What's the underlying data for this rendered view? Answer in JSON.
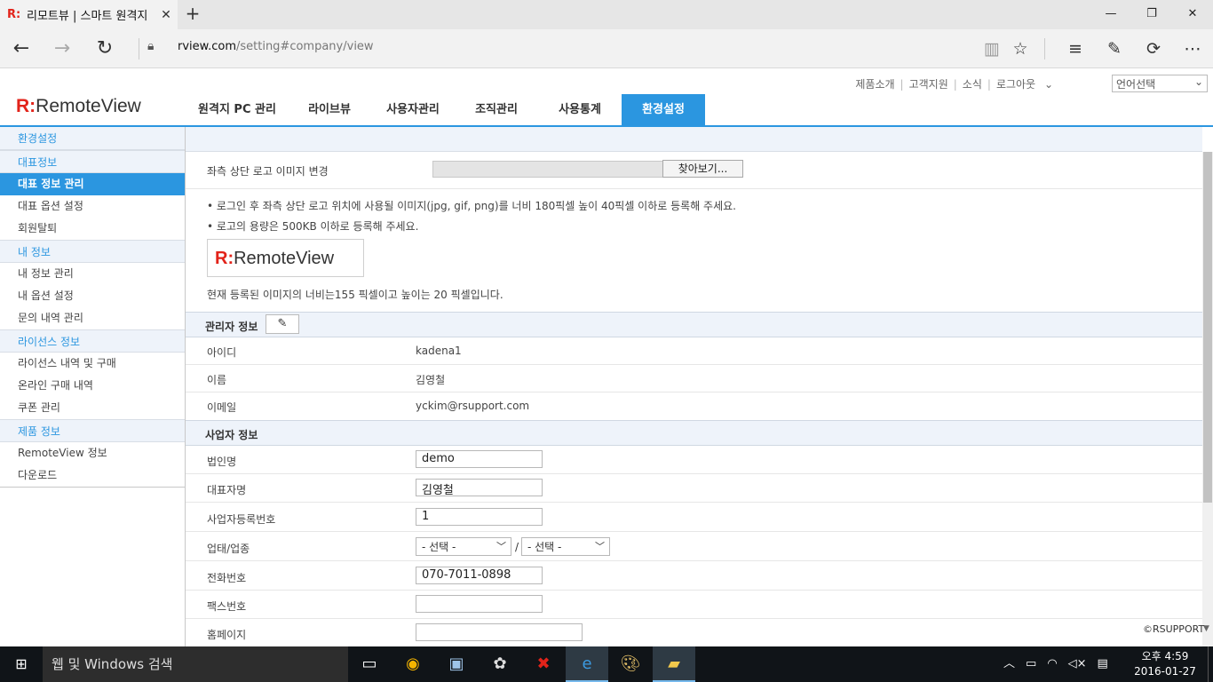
{
  "browser": {
    "tab_title": "리모트뷰 | 스마트 원격지",
    "tab_favicon": "R:",
    "url_host": "rview.com",
    "url_path": "/setting#company/view"
  },
  "header": {
    "logo_mark": "R:",
    "logo_text": "RemoteView",
    "top_links": [
      "제품소개",
      "고객지원",
      "소식",
      "로그아웃"
    ],
    "language_select": "언어선택",
    "nav": [
      "원격지 PC 관리",
      "라이브뷰",
      "사용자관리",
      "조직관리",
      "사용통계",
      "환경설정"
    ],
    "nav_active_index": 5
  },
  "sidebar": {
    "title": "환경설정",
    "sections": [
      {
        "title": "대표정보",
        "items": [
          "대표 정보 관리",
          "대표 옵션 설정",
          "회원탈퇴"
        ]
      },
      {
        "title": "내 정보",
        "items": [
          "내 정보 관리",
          "내 옵션 설정",
          "문의 내역 관리"
        ]
      },
      {
        "title": "라이선스 정보",
        "items": [
          "라이선스 내역 및 구매",
          "온라인 구매 내역",
          "쿠폰 관리"
        ]
      },
      {
        "title": "제품 정보",
        "items": [
          "RemoteView 정보",
          "다운로드"
        ]
      }
    ],
    "active_item": "대표 정보 관리"
  },
  "logo_section": {
    "label": "좌측 상단 로고 이미지 변경",
    "browse_button": "찾아보기...",
    "notes": [
      "로그인 후 좌측 상단 로고 위치에 사용될 이미지(jpg, gif, png)를 너비 180픽셀 높이 40픽셀 이하로 등록해 주세요.",
      "로고의 용량은 500KB 이하로 등록해 주세요."
    ],
    "preview_mark": "R:",
    "preview_text": "RemoteView",
    "current_size_text": "현재 등록된 이미지의 너비는155 픽셀이고 높이는 20 픽셀입니다."
  },
  "admin_info": {
    "title": "관리자 정보",
    "id_label": "아이디",
    "id_value": "kadena1",
    "name_label": "이름",
    "name_value": "김영철",
    "email_label": "이메일",
    "email_value": "yckim@rsupport.com"
  },
  "business_info": {
    "title": "사업자 정보",
    "corp_label": "법인명",
    "corp_value": "demo",
    "ceo_label": "대표자명",
    "ceo_value": "김영철",
    "regno_label": "사업자등록번호",
    "regno_value": "1",
    "biztype_label": "업태/업종",
    "biztype_select1": "- 선택 -",
    "biztype_select2": "- 선택 -",
    "biztype_sep": "/",
    "phone_label": "전화번호",
    "phone_value": "070-7011-0898",
    "fax_label": "팩스번호",
    "fax_value": "",
    "homepage_label": "홈페이지",
    "homepage_value": ""
  },
  "footer": {
    "copyright": "©RSUPPORT"
  },
  "taskbar": {
    "search_placeholder": "웹 및 Windows 검색",
    "clock_time": "오후 4:59",
    "clock_date": "2016-01-27"
  },
  "colors": {
    "accent": "#2b96e0",
    "brand_red": "#e2231a",
    "taskbar": "#101418"
  }
}
